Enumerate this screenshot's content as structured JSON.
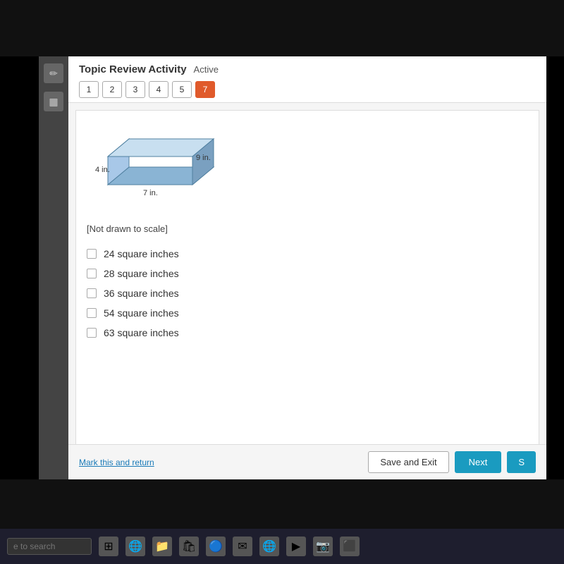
{
  "header": {
    "title": "Topic Review Activity",
    "status": "Active",
    "tabs": [
      {
        "label": "1",
        "active": false
      },
      {
        "label": "2",
        "active": false
      },
      {
        "label": "3",
        "active": false
      },
      {
        "label": "4",
        "active": false
      },
      {
        "label": "5",
        "active": false
      },
      {
        "label": "7",
        "active": true
      }
    ]
  },
  "figure": {
    "dimensions": {
      "length": "9 in.",
      "width": "7 in.",
      "height": "4 in."
    },
    "note": "[Not drawn to scale]"
  },
  "choices": [
    {
      "label": "24 square inches"
    },
    {
      "label": "28 square inches"
    },
    {
      "label": "36 square inches"
    },
    {
      "label": "54 square inches"
    },
    {
      "label": "63 square inches"
    }
  ],
  "footer": {
    "mark_return": "Mark this and return",
    "save_exit": "Save and Exit",
    "next": "Next",
    "submit": "S"
  },
  "taskbar": {
    "search_placeholder": "e to search"
  }
}
